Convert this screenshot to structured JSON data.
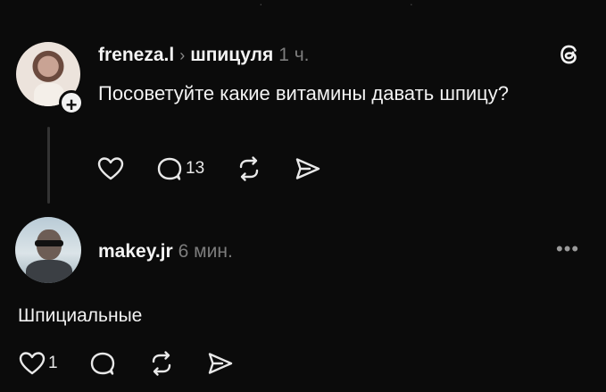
{
  "post": {
    "username": "freneza.l",
    "community": "шпицуля",
    "time": "1 ч.",
    "text": "Посоветуйте какие витамины давать шпицу?",
    "replies_count": "13"
  },
  "reply": {
    "username": "makey.jr",
    "time": "6 мин.",
    "text": "Шпициальные",
    "likes_count": "1"
  },
  "icons": {
    "post_actions": [
      "heart-icon",
      "comment-icon",
      "repost-icon",
      "share-icon"
    ],
    "reply_actions": [
      "heart-icon",
      "comment-icon",
      "repost-icon",
      "share-icon"
    ],
    "app": "threads-logo-icon",
    "menu": "more-icon"
  }
}
